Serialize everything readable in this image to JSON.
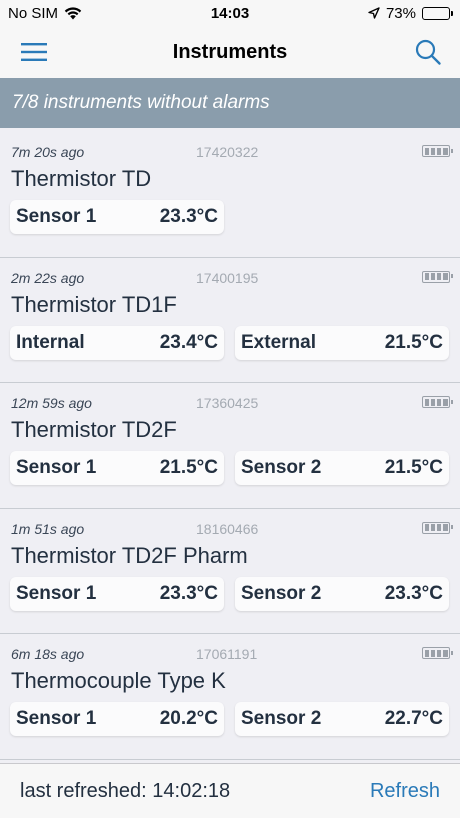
{
  "status_bar": {
    "carrier": "No SIM",
    "time": "14:03",
    "battery_percent": "73%",
    "battery_level": 0.73
  },
  "nav": {
    "title": "Instruments",
    "accent_color": "#2a7ab8"
  },
  "banner": {
    "text": "7/8 instruments without alarms"
  },
  "instruments": [
    {
      "time_ago": "7m 20s ago",
      "serial": "17420322",
      "name": "Thermistor TD",
      "sensors": [
        {
          "label": "Sensor 1",
          "value": "23.3°C"
        }
      ]
    },
    {
      "time_ago": "2m 22s ago",
      "serial": "17400195",
      "name": "Thermistor TD1F",
      "sensors": [
        {
          "label": "Internal",
          "value": "23.4°C"
        },
        {
          "label": "External",
          "value": "21.5°C"
        }
      ]
    },
    {
      "time_ago": "12m 59s ago",
      "serial": "17360425",
      "name": "Thermistor TD2F",
      "sensors": [
        {
          "label": "Sensor 1",
          "value": "21.5°C"
        },
        {
          "label": "Sensor 2",
          "value": "21.5°C"
        }
      ]
    },
    {
      "time_ago": "1m 51s ago",
      "serial": "18160466",
      "name": "Thermistor TD2F Pharm",
      "sensors": [
        {
          "label": "Sensor 1",
          "value": "23.3°C"
        },
        {
          "label": "Sensor 2",
          "value": "23.3°C"
        }
      ]
    },
    {
      "time_ago": "6m 18s ago",
      "serial": "17061191",
      "name": "Thermocouple Type K",
      "sensors": [
        {
          "label": "Sensor 1",
          "value": "20.2°C"
        },
        {
          "label": "Sensor 2",
          "value": "22.7°C"
        }
      ]
    }
  ],
  "footer": {
    "last_refreshed": "last refreshed: 14:02:18",
    "refresh_label": "Refresh"
  }
}
